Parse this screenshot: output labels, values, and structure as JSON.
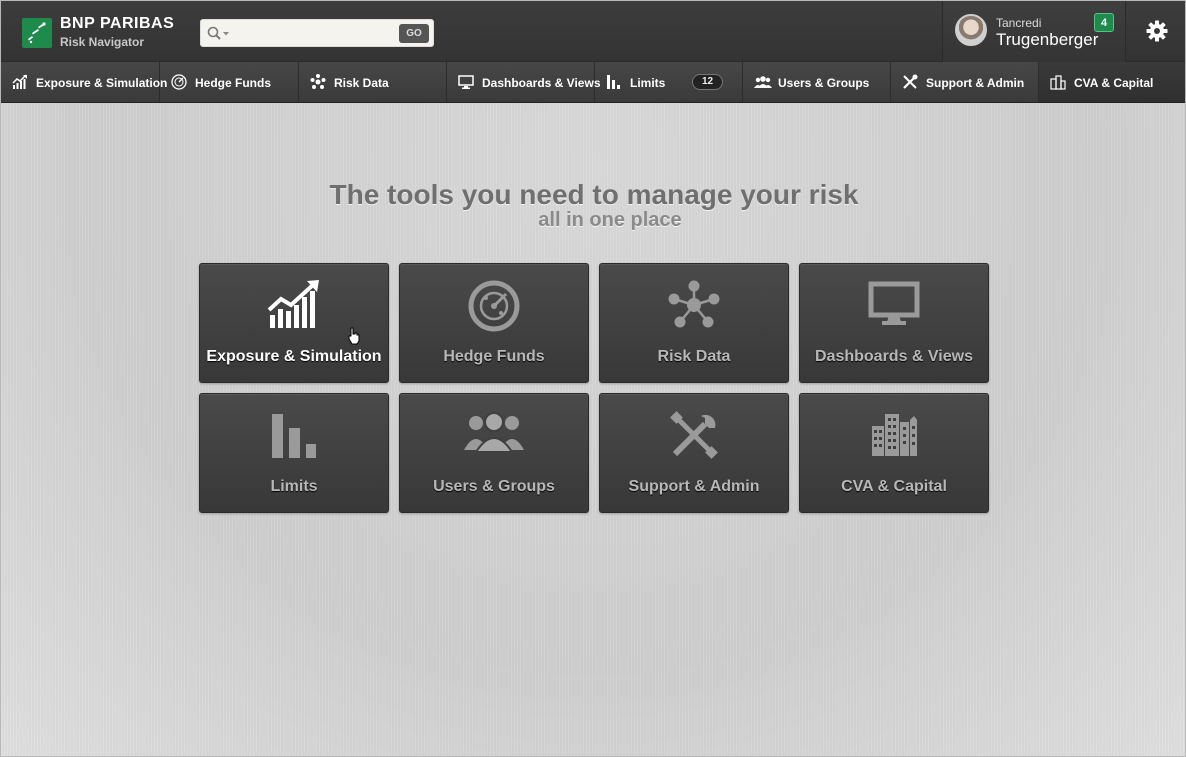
{
  "header": {
    "brand": "BNP PARIBAS",
    "product": "Risk Navigator",
    "search": {
      "value": "",
      "placeholder": "",
      "button_label": "GO"
    },
    "user": {
      "first_name": "Tancredi",
      "last_name": "Trugenberger",
      "notification_count": "4"
    },
    "settings_icon": "gear-icon",
    "brand_color": "#1e8a4c"
  },
  "nav": {
    "items": [
      {
        "label": "Exposure & Simulation",
        "icon": "trend-chart-icon"
      },
      {
        "label": "Hedge Funds",
        "icon": "radar-icon"
      },
      {
        "label": "Risk Data",
        "icon": "network-icon"
      },
      {
        "label": "Dashboards & Views",
        "icon": "monitor-icon"
      },
      {
        "label": "Limits",
        "icon": "bar-chart-icon",
        "count": "12"
      },
      {
        "label": "Users & Groups",
        "icon": "users-icon"
      },
      {
        "label": "Support & Admin",
        "icon": "tools-icon"
      },
      {
        "label": "CVA & Capital",
        "icon": "buildings-icon",
        "active": true
      }
    ]
  },
  "main": {
    "headline": "The tools you need to manage your risk",
    "subheadline": "all in one place",
    "tiles": [
      {
        "label": "Exposure & Simulation",
        "icon": "trend-chart-icon",
        "hovered": true
      },
      {
        "label": "Hedge Funds",
        "icon": "radar-icon"
      },
      {
        "label": "Risk Data",
        "icon": "network-icon"
      },
      {
        "label": "Dashboards & Views",
        "icon": "monitor-icon"
      },
      {
        "label": "Limits",
        "icon": "bar-chart-icon"
      },
      {
        "label": "Users & Groups",
        "icon": "users-icon"
      },
      {
        "label": "Support & Admin",
        "icon": "tools-icon"
      },
      {
        "label": "CVA & Capital",
        "icon": "buildings-icon"
      }
    ]
  }
}
